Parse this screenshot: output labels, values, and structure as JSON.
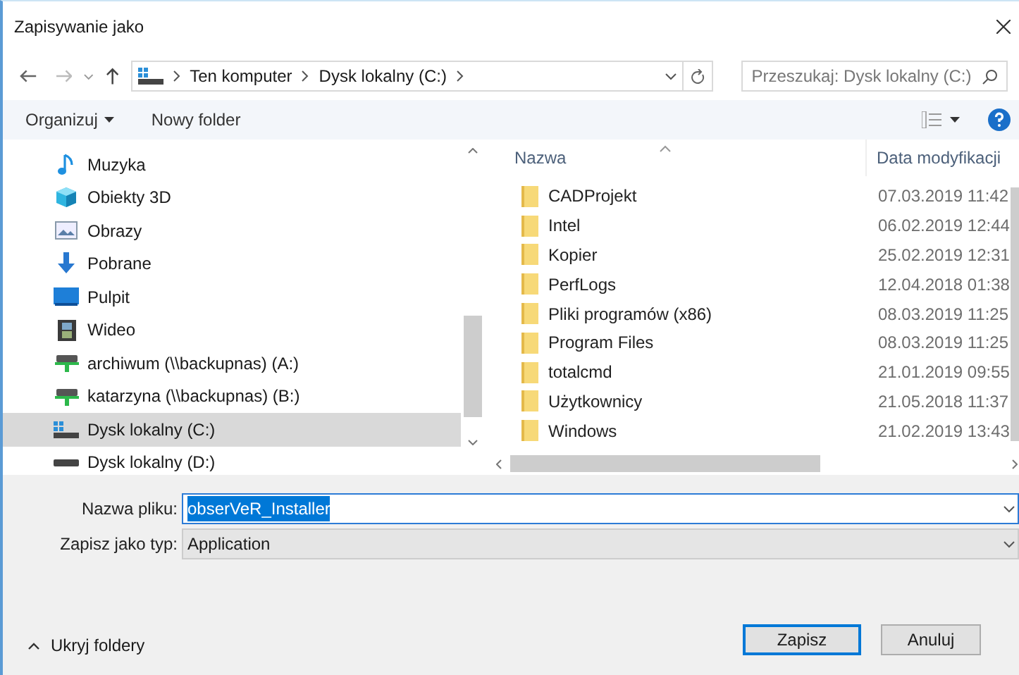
{
  "window": {
    "title": "Zapisywanie jako"
  },
  "address": {
    "segments": [
      "Ten komputer",
      "Dysk lokalny (C:)"
    ]
  },
  "search": {
    "placeholder": "Przeszukaj: Dysk lokalny (C:)"
  },
  "toolbar": {
    "organize": "Organizuj",
    "new_folder": "Nowy folder"
  },
  "sidebar": {
    "items": [
      {
        "label": "Muzyka",
        "kind": "music",
        "selected": false
      },
      {
        "label": "Obiekty 3D",
        "kind": "cube",
        "selected": false
      },
      {
        "label": "Obrazy",
        "kind": "pictures",
        "selected": false
      },
      {
        "label": "Pobrane",
        "kind": "download",
        "selected": false
      },
      {
        "label": "Pulpit",
        "kind": "desktop",
        "selected": false
      },
      {
        "label": "Wideo",
        "kind": "video",
        "selected": false
      },
      {
        "label": "archiwum (\\\\backupnas) (A:)",
        "kind": "netdrive",
        "selected": false
      },
      {
        "label": "katarzyna (\\\\backupnas) (B:)",
        "kind": "netdrive",
        "selected": false
      },
      {
        "label": "Dysk lokalny (C:)",
        "kind": "sysdrive",
        "selected": true
      },
      {
        "label": "Dysk lokalny (D:)",
        "kind": "drive",
        "selected": false
      }
    ]
  },
  "table": {
    "columns": [
      "Nazwa",
      "Data modyfikacji"
    ],
    "rows": [
      {
        "name": "CADProjekt",
        "date": "07.03.2019 11:42"
      },
      {
        "name": "Intel",
        "date": "06.02.2019 12:44"
      },
      {
        "name": "Kopier",
        "date": "25.02.2019 12:31"
      },
      {
        "name": "PerfLogs",
        "date": "12.04.2018 01:38"
      },
      {
        "name": "Pliki programów (x86)",
        "date": "08.03.2019 11:25"
      },
      {
        "name": "Program Files",
        "date": "08.03.2019 11:25"
      },
      {
        "name": "totalcmd",
        "date": "21.01.2019 09:55"
      },
      {
        "name": "Użytkownicy",
        "date": "21.05.2018 11:37"
      },
      {
        "name": "Windows",
        "date": "21.02.2019 13:43"
      }
    ]
  },
  "file_name": {
    "label": "Nazwa pliku:",
    "value": "obserVeR_Installer"
  },
  "file_type": {
    "label": "Zapisz jako typ:",
    "value": "Application"
  },
  "hide_folders": "Ukryj foldery",
  "buttons": [
    "Zapisz",
    "Anuluj"
  ]
}
